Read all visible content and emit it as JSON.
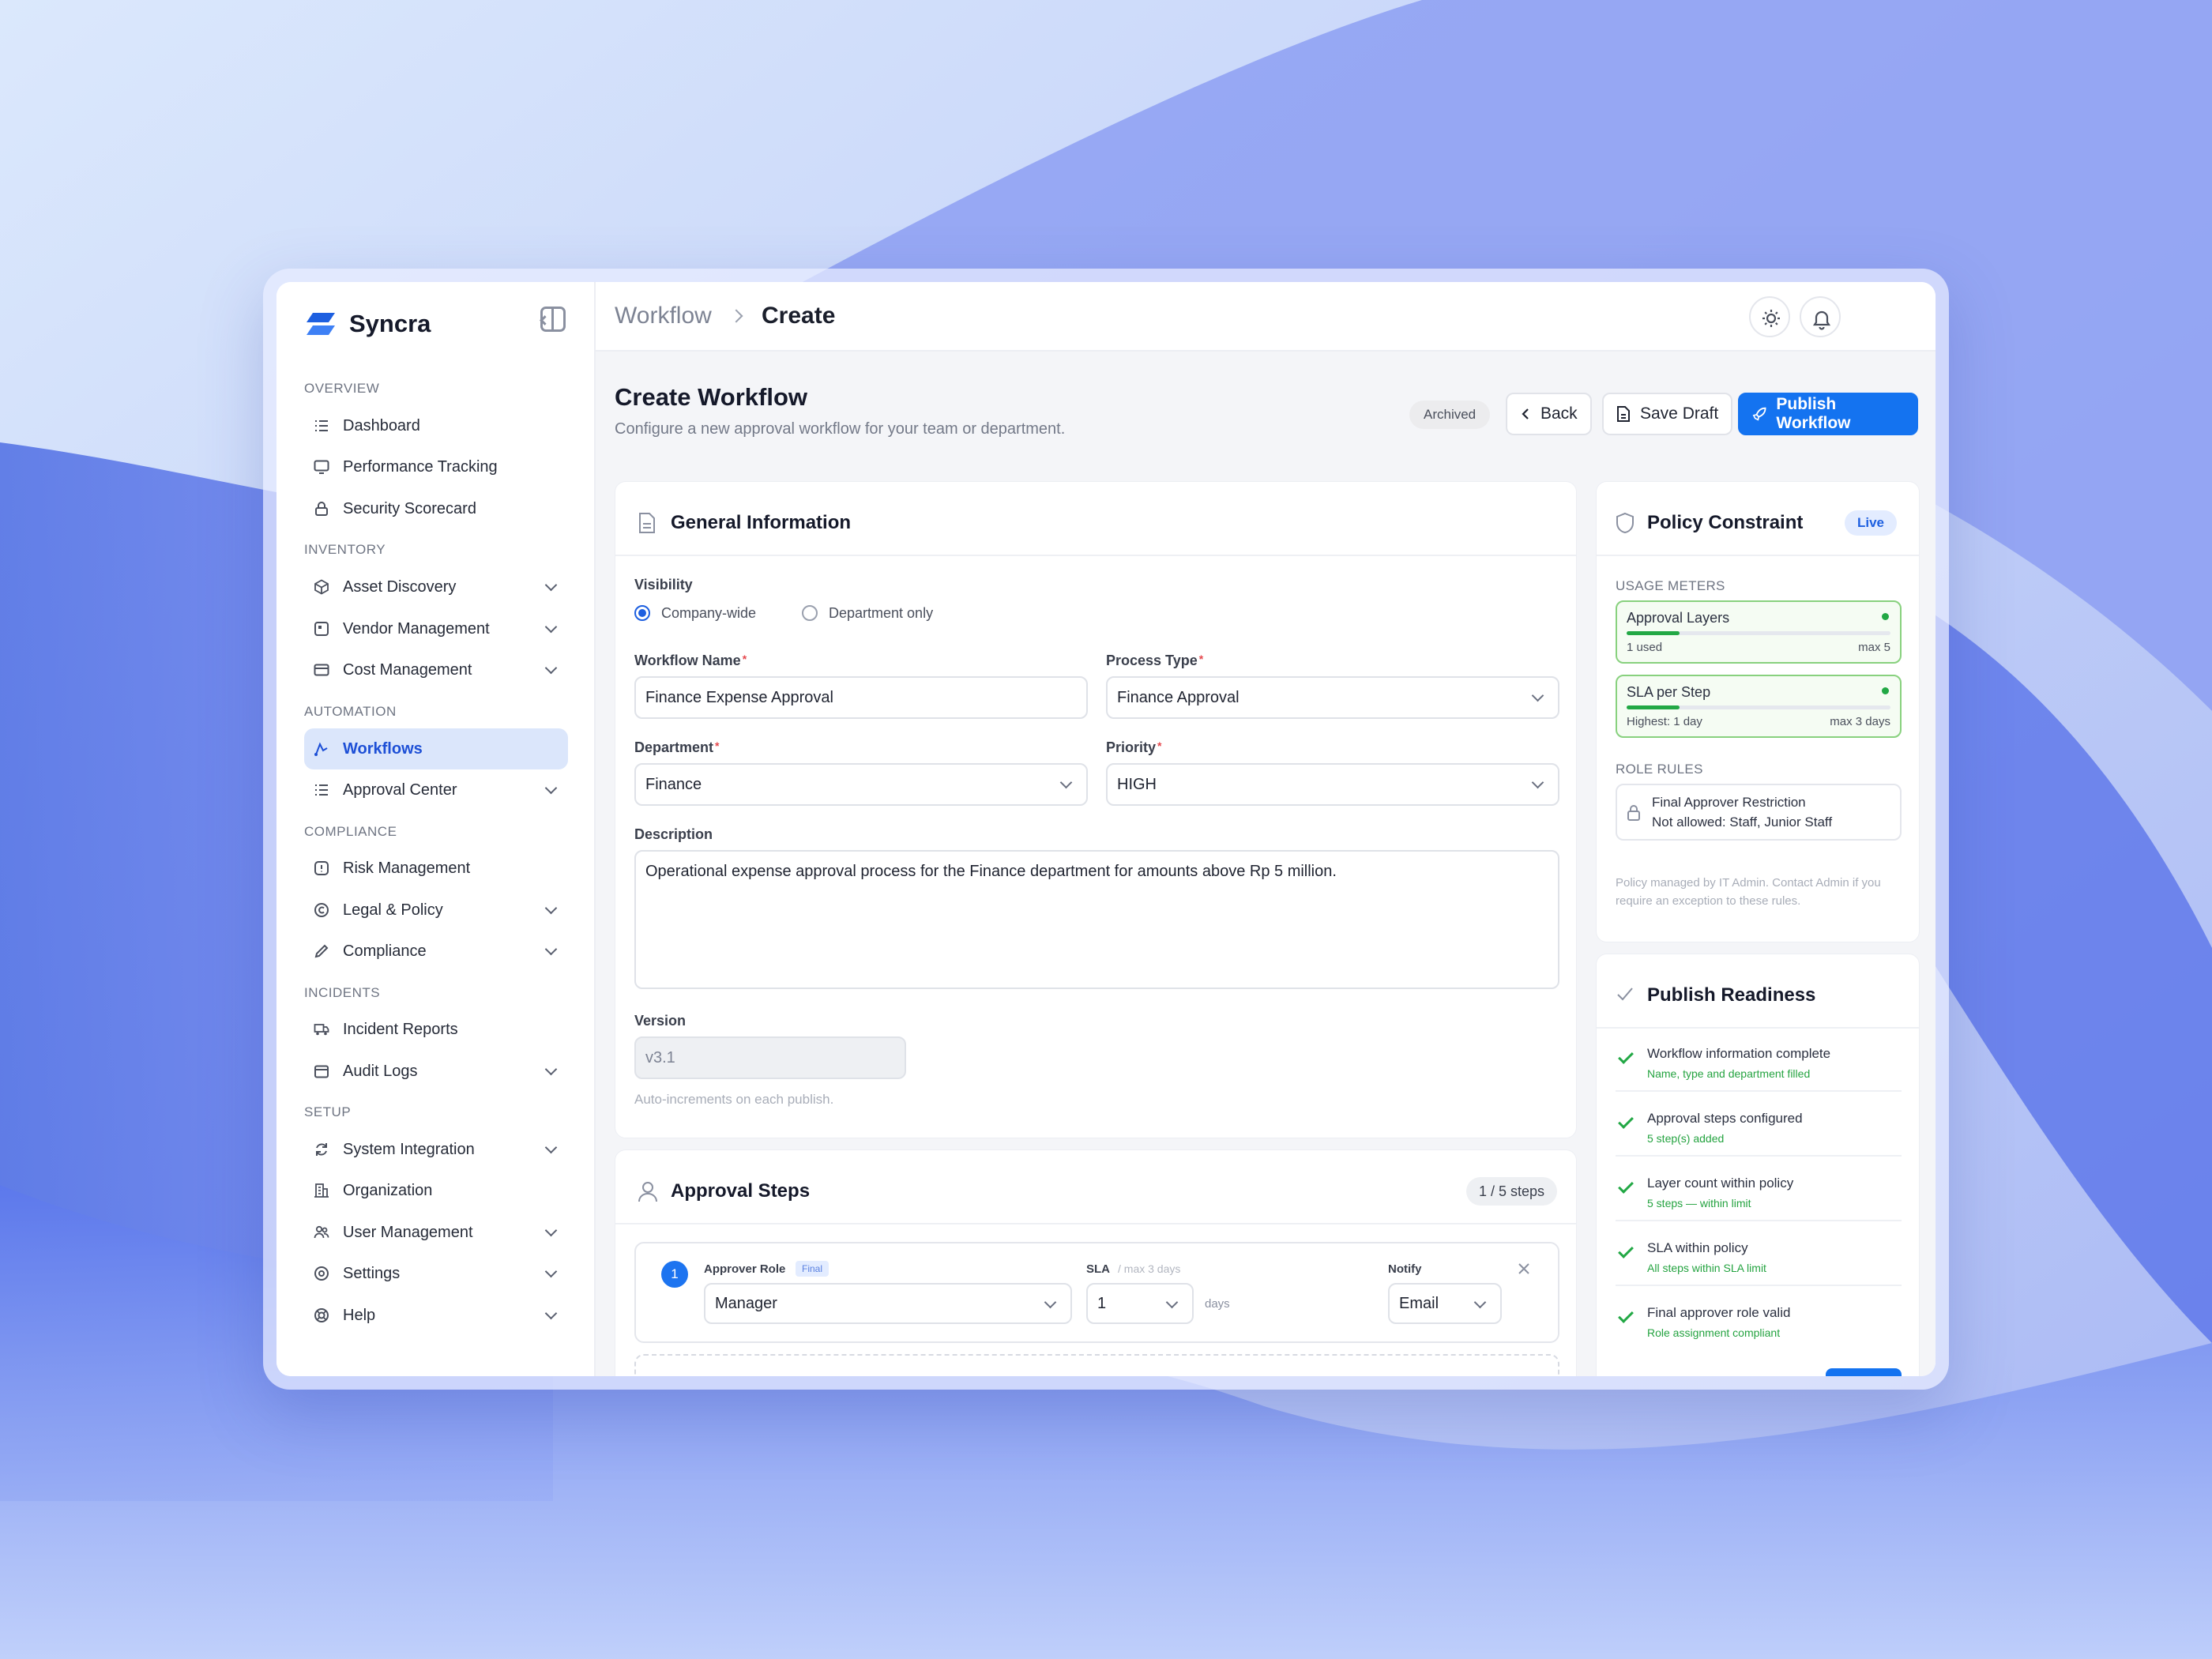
{
  "brand": {
    "name": "Syncra"
  },
  "breadcrumb": {
    "parent": "Workflow",
    "current": "Create"
  },
  "sidebar": {
    "sections": [
      {
        "label": "OVERVIEW"
      },
      {
        "label": "INVENTORY"
      },
      {
        "label": "AUTOMATION"
      },
      {
        "label": "COMPLIANCE"
      },
      {
        "label": "INCIDENTS"
      },
      {
        "label": "SETUP"
      }
    ],
    "items": [
      {
        "label": "Dashboard",
        "icon": "list-icon"
      },
      {
        "label": "Performance Tracking",
        "icon": "monitor-icon"
      },
      {
        "label": "Security Scorecard",
        "icon": "lock-icon"
      },
      {
        "label": "Asset Discovery",
        "icon": "cube-icon"
      },
      {
        "label": "Vendor Management",
        "icon": "vendor-icon"
      },
      {
        "label": "Cost Management",
        "icon": "card-icon"
      },
      {
        "label": "Workflows",
        "icon": "workflow-icon"
      },
      {
        "label": "Approval Center",
        "icon": "list-icon"
      },
      {
        "label": "Risk Management",
        "icon": "alert-icon"
      },
      {
        "label": "Legal & Policy",
        "icon": "copyright-icon"
      },
      {
        "label": "Compliance",
        "icon": "pencil-icon"
      },
      {
        "label": "Incident Reports",
        "icon": "truck-icon"
      },
      {
        "label": "Audit Logs",
        "icon": "calendar-icon"
      },
      {
        "label": "System Integration",
        "icon": "refresh-icon"
      },
      {
        "label": "Organization",
        "icon": "building-icon"
      },
      {
        "label": "User Management",
        "icon": "users-icon"
      },
      {
        "label": "Settings",
        "icon": "gear-icon"
      },
      {
        "label": "Help",
        "icon": "lifebuoy-icon"
      }
    ]
  },
  "page": {
    "title": "Create Workflow",
    "subtitle": "Configure a new approval workflow for your team or department.",
    "status": "Archived",
    "back_label": "Back",
    "save_label": "Save Draft",
    "publish_label": "Publish Workflow"
  },
  "general": {
    "title": "General Information",
    "visibility_label": "Visibility",
    "visibility_options": [
      "Company-wide",
      "Department only"
    ],
    "workflow_name_label": "Workflow Name",
    "workflow_name": "Finance Expense Approval",
    "process_type_label": "Process Type",
    "process_type": "Finance Approval",
    "department_label": "Department",
    "department": "Finance",
    "priority_label": "Priority",
    "priority": "HIGH",
    "description_label": "Description",
    "description": "Operational expense approval process for the Finance department for amounts above Rp 5 million.",
    "version_label": "Version",
    "version": "v3.1",
    "version_hint": "Auto-increments on each publish."
  },
  "steps": {
    "title": "Approval Steps",
    "count": "1 / 5 steps",
    "step_number": "1",
    "approver_label": "Approver Role",
    "final_badge": "Final",
    "approver_value": "Manager",
    "sla_label": "SLA",
    "sla_hint": "/ max 3 days",
    "sla_value": "1",
    "sla_unit": "days",
    "notify_label": "Notify",
    "notify_value": "Email"
  },
  "policy": {
    "title": "Policy Constraint",
    "live": "Live",
    "usage_label": "USAGE METERS",
    "meters": [
      {
        "title": "Approval Layers",
        "left": "1 used",
        "right": "max 5",
        "fraction": 0.2
      },
      {
        "title": "SLA per Step",
        "left": "Highest: 1 day",
        "right": "max 3 days",
        "fraction": 0.2
      }
    ],
    "role_rules_label": "ROLE RULES",
    "rule_title": "Final Approver Restriction",
    "rule_desc": "Not allowed: Staff, Junior Staff",
    "note": "Policy managed by IT Admin. Contact Admin if you require an exception to these rules."
  },
  "readiness": {
    "title": "Publish Readiness",
    "items": [
      {
        "title": "Workflow information complete",
        "sub": "Name, type and department filled"
      },
      {
        "title": "Approval steps configured",
        "sub": "5 step(s) added"
      },
      {
        "title": "Layer count within policy",
        "sub": "5 steps — within limit"
      },
      {
        "title": "SLA within policy",
        "sub": "All steps within SLA limit"
      },
      {
        "title": "Final approver role valid",
        "sub": "Role assignment compliant"
      }
    ]
  },
  "colors": {
    "accent": "#1473f0",
    "success": "#22a845",
    "active_nav": "#dbe6fb"
  }
}
